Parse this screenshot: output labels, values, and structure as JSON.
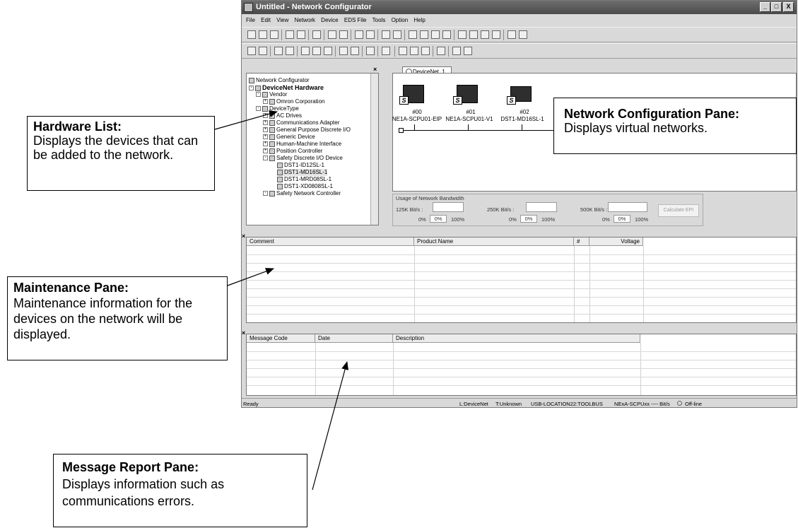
{
  "window": {
    "title": "Untitled - Network Configurator",
    "buttons": [
      "_",
      "□",
      "X"
    ]
  },
  "menu": [
    "File",
    "Edit",
    "View",
    "Network",
    "Device",
    "EDS File",
    "Tools",
    "Option",
    "Help"
  ],
  "tree": {
    "items": [
      "Network Configurator",
      "DeviceNet Hardware",
      "Vendor",
      "Omron Corporation",
      "DeviceType",
      "AC Drives",
      "Communications Adapter",
      "General Purpose Discrete I/O",
      "Generic Device",
      "Human-Machine Interface",
      "Position Controller",
      "Safety Discrete I/O Device",
      "DST1-ID12SL-1",
      "DST1-MD16SL-1",
      "DST1-MRD08SL-1",
      "DST1-XD0808SL-1",
      "Safety Network Controller"
    ]
  },
  "network": {
    "tab": "DeviceNet_1",
    "devices": [
      {
        "addr": "#00",
        "name": "NE1A-SCPU01-EIP"
      },
      {
        "addr": "#01",
        "name": "NE1A-SCPU01-V1"
      },
      {
        "addr": "#02",
        "name": "DST1-MD16SL-1"
      }
    ],
    "badge": "S"
  },
  "bandwidth": {
    "title": "Usage of Network Bandwidth",
    "items": [
      {
        "label": "125K Bit/s :",
        "left": "0%",
        "value": "0%",
        "right": "100%"
      },
      {
        "label": "250K Bit/s :",
        "left": "0%",
        "value": "0%",
        "right": "100%"
      },
      {
        "label": "500K Bit/s :",
        "left": "0%",
        "value": "0%",
        "right": "100%"
      }
    ],
    "button": "Calculate EPI"
  },
  "maintenance": {
    "headers": [
      "Comment",
      "Product Name",
      "#",
      "Voltage"
    ]
  },
  "messages": {
    "headers": [
      "Message Code",
      "Date",
      "Description"
    ]
  },
  "close_mark": "×",
  "status": {
    "left": "Ready",
    "net": "L:DeviceNet",
    "type": "T:Unknown",
    "loc": "USB-LOCATION22:TOOLBUS",
    "rate": "NExA-SCPUxx ---- Bit/s",
    "mode": "Off-line"
  },
  "callouts": {
    "hardware": {
      "title": "Hardware List:",
      "body": "Displays the devices that can be added to the network."
    },
    "network": {
      "title": "Network Configuration Pane:",
      "body": "Displays virtual networks."
    },
    "maintenance": {
      "title": "Maintenance Pane:",
      "body": "Maintenance information for the devices on the network will be displayed."
    },
    "message": {
      "title": "Message Report Pane:",
      "body": "Displays information such as communications errors."
    }
  }
}
